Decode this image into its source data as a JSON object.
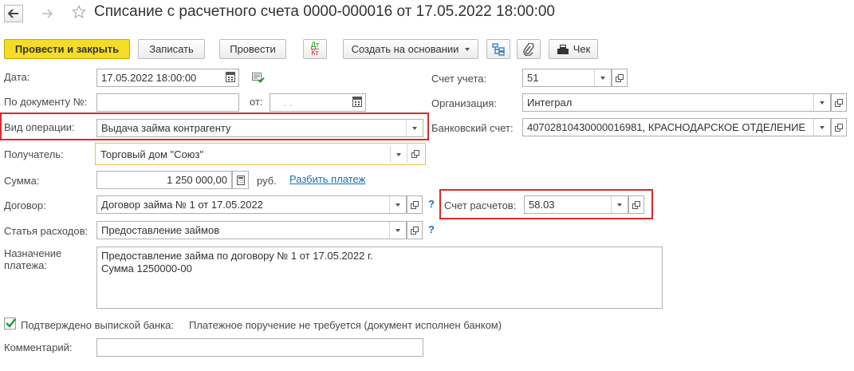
{
  "header": {
    "title": "Списание с расчетного счета 0000-000016 от 17.05.2022 18:00:00",
    "back_icon": "arrow-left-icon",
    "forward_icon": "arrow-right-icon",
    "star_icon": "star-outline-icon"
  },
  "toolbar": {
    "post_close": "Провести и закрыть",
    "save": "Записать",
    "post": "Провести",
    "dtkt_top": "Дт",
    "dtkt_bottom": "Кт",
    "create_based": "Создать на основании",
    "receipt": "Чек",
    "accent_color": "#f4dc27"
  },
  "form": {
    "date_label": "Дата:",
    "date_value": "17.05.2022 18:00:00",
    "doc_num_label": "По документу №:",
    "doc_num_value": "",
    "from_label": "от:",
    "from_value": ". .",
    "operation_label": "Вид операции:",
    "operation_value": "Выдача займа контрагенту",
    "recipient_label": "Получатель:",
    "recipient_value": "Торговый дом \"Союз\"",
    "amount_label": "Сумма:",
    "amount_value": "1 250 000,00",
    "currency": "руб.",
    "split_link": "Разбить платеж",
    "contract_label": "Договор:",
    "contract_value": "Договор займа № 1 от 17.05.2022",
    "expense_label": "Статья расходов:",
    "expense_value": "Предоставление займов",
    "purpose_label": "Назначение платежа:",
    "purpose_value": "Предоставление займа по договору № 1 от 17.05.2022 г.\nСумма 1250000-00",
    "confirmed_label": "Подтверждено выпиской банка:",
    "confirmed_checked": true,
    "confirmed_note": "Платежное поручение не требуется (документ исполнен банком)",
    "comment_label": "Комментарий:",
    "comment_value": "",
    "account_label": "Счет учета:",
    "account_value": "51",
    "org_label": "Организация:",
    "org_value": "Интеграл",
    "bank_label": "Банковский счет:",
    "bank_value": "40702810430000016981, КРАСНОДАРСКОЕ ОТДЕЛЕНИЕ",
    "settle_label": "Счет расчетов:",
    "settle_value": "58.03",
    "help_mark": "?",
    "highlight_color": "#d82a2a"
  }
}
